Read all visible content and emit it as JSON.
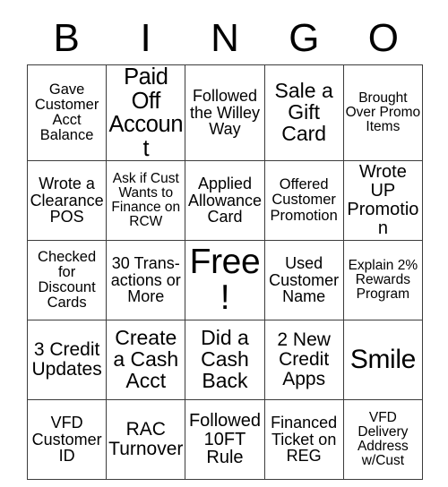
{
  "card": {
    "title_letters": [
      "B",
      "I",
      "N",
      "G",
      "O"
    ],
    "rows": [
      [
        {
          "text": "Gave Customer Acct Balance",
          "size": "fs-16"
        },
        {
          "text": "Paid Off Account",
          "size": "fs-25"
        },
        {
          "text": "Followed the Willey Way",
          "size": "fs-18"
        },
        {
          "text": "Sale a Gift Card",
          "size": "fs-23"
        },
        {
          "text": "Brought Over Promo Items",
          "size": "fs-15"
        }
      ],
      [
        {
          "text": "Wrote a Clearance POS",
          "size": "fs-18"
        },
        {
          "text": "Ask if Cust Wants to Finance on RCW",
          "size": "fs-15"
        },
        {
          "text": "Applied Allowance Card",
          "size": "fs-18"
        },
        {
          "text": "Offered Customer Promotion",
          "size": "fs-16"
        },
        {
          "text": "Wrote UP Promotion",
          "size": "fs-20"
        }
      ],
      [
        {
          "text": "Checked for Discount Cards",
          "size": "fs-16"
        },
        {
          "text": "30 Trans-actions or More",
          "size": "fs-18"
        },
        {
          "text": "Free!",
          "size": "fs-38"
        },
        {
          "text": "Used Customer Name",
          "size": "fs-18"
        },
        {
          "text": "Explain 2% Rewards Program",
          "size": "fs-15"
        }
      ],
      [
        {
          "text": "3 Credit Updates",
          "size": "fs-21"
        },
        {
          "text": "Create a Cash Acct",
          "size": "fs-23"
        },
        {
          "text": "Did a Cash Back",
          "size": "fs-23"
        },
        {
          "text": "2 New Credit Apps",
          "size": "fs-21"
        },
        {
          "text": "Smile",
          "size": "fs-30"
        }
      ],
      [
        {
          "text": "VFD Customer ID",
          "size": "fs-18"
        },
        {
          "text": "RAC Turnover",
          "size": "fs-21"
        },
        {
          "text": "Followed 10FT Rule",
          "size": "fs-20"
        },
        {
          "text": "Financed Ticket on REG",
          "size": "fs-18"
        },
        {
          "text": "VFD Delivery Address w/Cust",
          "size": "fs-15"
        }
      ]
    ]
  },
  "colors": {
    "background": "#ffffff",
    "text": "#000000",
    "grid_line": "#3c3c3c"
  }
}
